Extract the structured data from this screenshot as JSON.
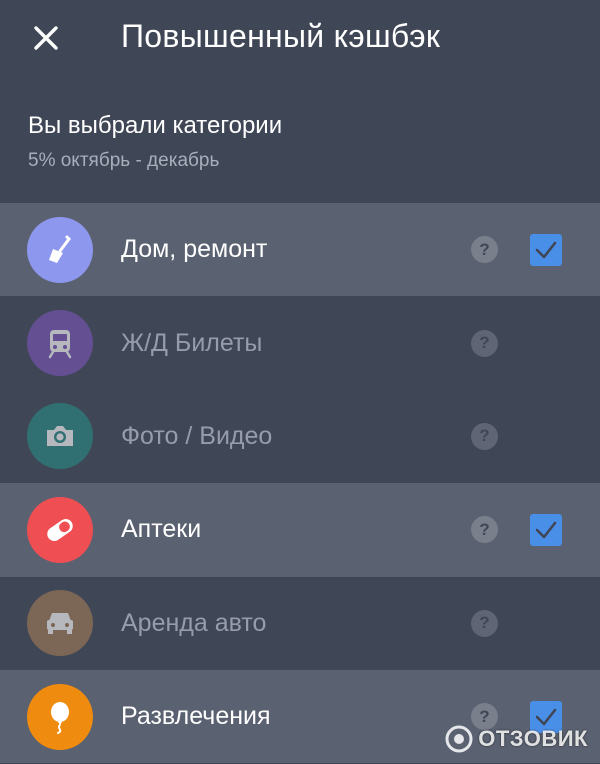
{
  "header": {
    "title": "Повышенный кэшбэк",
    "close_icon": "close-icon"
  },
  "intro": {
    "title": "Вы выбрали категории",
    "subtitle": "5% октябрь - декабрь"
  },
  "categories": [
    {
      "label": "Дом, ремонт",
      "icon": "trowel-icon",
      "color": "#8e97ee",
      "selected": true,
      "help": "?"
    },
    {
      "label": "Ж/Д Билеты",
      "icon": "train-icon",
      "color": "#7a55b8",
      "selected": false,
      "help": "?"
    },
    {
      "label": "Фото / Видео",
      "icon": "camera-icon",
      "color": "#2a8a84",
      "selected": false,
      "help": "?"
    },
    {
      "label": "Аптеки",
      "icon": "pill-icon",
      "color": "#ef4f53",
      "selected": true,
      "help": "?"
    },
    {
      "label": "Аренда авто",
      "icon": "car-icon",
      "color": "#a27a55",
      "selected": false,
      "help": "?"
    },
    {
      "label": "Развлечения",
      "icon": "balloon-icon",
      "color": "#ef8c10",
      "selected": true,
      "help": "?"
    }
  ],
  "watermark": {
    "text": "ОТЗОВИК"
  },
  "colors": {
    "background": "#3f4656",
    "selected_row": "#5a6170",
    "checkbox": "#4a8fe7"
  }
}
